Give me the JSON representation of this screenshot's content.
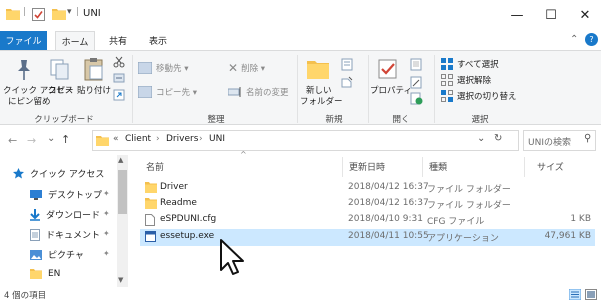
{
  "window": {
    "title": "UNI",
    "minimize_glyph": "—",
    "maximize_glyph": "☐",
    "close_glyph": "✕",
    "qat_separator": "|",
    "qat_dropdown": "▾"
  },
  "ribbon_tabs": {
    "file": "ファイル",
    "home": "ホーム",
    "share": "共有",
    "view": "表示",
    "collapse_glyph": "⌃",
    "help_glyph": "?"
  },
  "ribbon": {
    "clipboard": {
      "group_label": "クリップボード",
      "pin_label_line1": "クイック アクセス",
      "pin_label_line2": "にピン留め",
      "copy_label": "コピー",
      "paste_label": "貼り付け"
    },
    "organize": {
      "group_label": "整理",
      "move_to": "移動先 ▾",
      "delete": "削除 ▾",
      "copy_to": "コピー先 ▾",
      "rename": "名前の変更"
    },
    "new": {
      "group_label": "新規",
      "new_folder_line1": "新しい",
      "new_folder_line2": "フォルダー"
    },
    "open": {
      "group_label": "開く",
      "properties": "プロパティ"
    },
    "select": {
      "group_label": "選択",
      "select_all": "すべて選択",
      "select_none": "選択解除",
      "invert_selection": "選択の切り替え"
    }
  },
  "address": {
    "back_glyph": "←",
    "forward_glyph": "→",
    "recent_glyph": "⌄",
    "up_glyph": "↑",
    "crumb_prefix": "«",
    "path": [
      "Client",
      "Drivers",
      "UNI"
    ],
    "path_separator": "›",
    "dropdown_glyph": "⌄",
    "refresh_glyph": "↻",
    "search_placeholder": "UNIの検索",
    "search_glyph": "⚲"
  },
  "nav": {
    "items": [
      {
        "label": "クイック アクセス",
        "icon": "star-icon",
        "pinned": false
      },
      {
        "label": "デスクトップ",
        "icon": "desktop-icon",
        "pinned": true
      },
      {
        "label": "ダウンロード",
        "icon": "download-arrow-icon",
        "pinned": true
      },
      {
        "label": "ドキュメント",
        "icon": "document-icon",
        "pinned": true
      },
      {
        "label": "ピクチャ",
        "icon": "pictures-icon",
        "pinned": true
      },
      {
        "label": "EN",
        "icon": "folder-icon",
        "pinned": false
      }
    ],
    "pin_glyph": "✦"
  },
  "columns": {
    "name": "名前",
    "modified": "更新日時",
    "type": "種類",
    "size": "サイズ",
    "sort_glyph": "^"
  },
  "files": [
    {
      "name": "Driver",
      "modified": "2018/04/12 16:37",
      "type": "ファイル フォルダー",
      "size": "",
      "icon": "folder-icon"
    },
    {
      "name": "Readme",
      "modified": "2018/04/12 16:37",
      "type": "ファイル フォルダー",
      "size": "",
      "icon": "folder-icon"
    },
    {
      "name": "eSPDUNI.cfg",
      "modified": "2018/04/10 9:31",
      "type": "CFG ファイル",
      "size": "1 KB",
      "icon": "cfg-file-icon"
    },
    {
      "name": "essetup.exe",
      "modified": "2018/04/11 10:55",
      "type": "アプリケーション",
      "size": "47,961 KB",
      "icon": "exe-file-icon",
      "selected": true
    }
  ],
  "status": {
    "item_count": "4 個の項目"
  },
  "colors": {
    "accent": "#1979ca",
    "selection": "#cce8ff",
    "folder": "#f4c04e",
    "ribbon_bg": "#f5f6f7"
  }
}
